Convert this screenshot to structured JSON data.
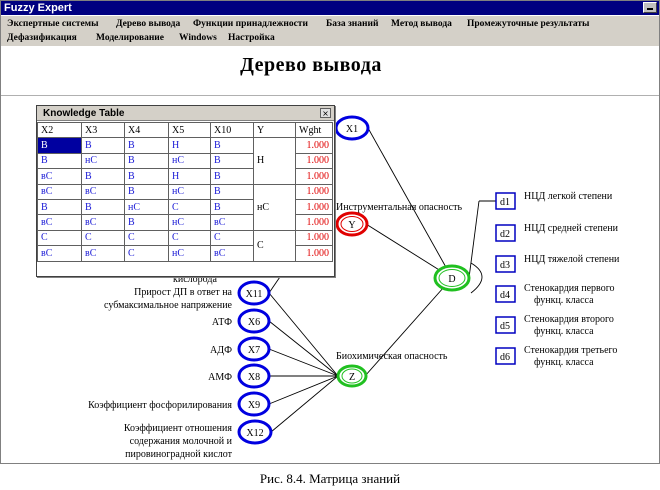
{
  "window": {
    "title": "Fuzzy Expert"
  },
  "menu": {
    "row1": [
      "Экспертные системы",
      "Дерево вывода",
      "Функции принадлежности",
      "База знаний",
      "Метод вывода",
      "Промежуточные результаты"
    ],
    "row2": [
      "Дефазификация",
      "Моделирование",
      "Windows",
      "Настройка"
    ]
  },
  "page_title": "Дерево вывода",
  "knowledge_table": {
    "title": "Knowledge Table",
    "close": "×",
    "headers": [
      "X2",
      "X3",
      "X4",
      "X5",
      "X10",
      "Y",
      "Wght"
    ],
    "rows": [
      [
        "В",
        "В",
        "В",
        "Н",
        "В",
        "1.000"
      ],
      [
        "В",
        "нС",
        "В",
        "нС",
        "В",
        "1.000"
      ],
      [
        "вС",
        "В",
        "В",
        "Н",
        "В",
        "1.000"
      ],
      [
        "вС",
        "вС",
        "В",
        "нС",
        "В",
        "1.000"
      ],
      [
        "В",
        "В",
        "нС",
        "С",
        "В",
        "1.000"
      ],
      [
        "вС",
        "вС",
        "В",
        "нС",
        "вС",
        "1.000"
      ],
      [
        "С",
        "С",
        "С",
        "С",
        "С",
        "1.000"
      ],
      [
        "вС",
        "вС",
        "С",
        "нС",
        "вС",
        "1.000"
      ]
    ],
    "y_groups": [
      "Н",
      "нС",
      "С"
    ]
  },
  "tree": {
    "nodes": {
      "X1": "X1",
      "Y": "Y",
      "D": "D",
      "Z": "Z",
      "X11": "X11",
      "X6": "X6",
      "X7": "X7",
      "X8": "X8",
      "X9": "X9",
      "X12": "X12",
      "d1": "d1",
      "d2": "d2",
      "d3": "d3",
      "d4": "d4",
      "d5": "d5",
      "d6": "d6"
    },
    "labels": {
      "instr": "Инструментальная опасность",
      "bio": "Биохимическая опасность",
      "kisloroda": "кислорода",
      "x11_l1": "Прирост ДП в ответ на",
      "x11_l2": "субмаксимальное напряжение",
      "atf": "АТФ",
      "adf": "АДФ",
      "amf": "АМФ",
      "x9": "Коэффициент фосфорилирования",
      "x12_l1": "Коэффициент отношения",
      "x12_l2": "содержания молочной и",
      "x12_l3": "пировиноградной кислот",
      "d1": "НЦД легкой степени",
      "d2": "НЦД средней степени",
      "d3": "НЦД тяжелой степени",
      "d4_l1": "Стенокардия первого",
      "d4_l2": "функц. класса",
      "d5_l1": "Стенокардия второго",
      "d5_l2": "функц. класса",
      "d6_l1": "Стенокардия третьего",
      "d6_l2": "функц. класса"
    },
    "colors": {
      "blue": "#0000e0",
      "red": "#e00000",
      "green": "#20c020",
      "dnode": "#0000c0"
    }
  },
  "caption": "Рис. 8.4. Матрица знаний"
}
